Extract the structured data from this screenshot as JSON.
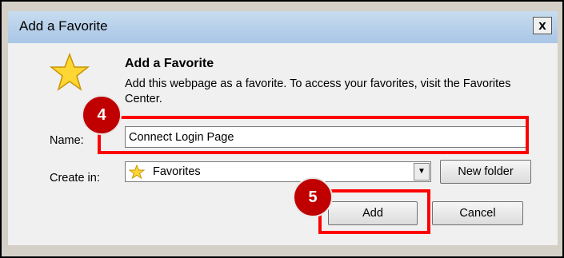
{
  "dialog": {
    "title": "Add a Favorite",
    "close_label": "x",
    "heading": "Add a Favorite",
    "description": "Add this webpage as a favorite. To access your favorites, visit the Favorites Center."
  },
  "form": {
    "name_label": "Name:",
    "name_value": "Connect Login Page",
    "create_in_label": "Create in:",
    "create_in_selected": "Favorites",
    "new_folder_label": "New folder"
  },
  "buttons": {
    "add_label": "Add",
    "cancel_label": "Cancel"
  },
  "annotations": {
    "step_4": "4",
    "step_5": "5",
    "highlight_color": "#ff0000",
    "badge_color": "#c00000"
  },
  "icons": {
    "favorite_large": "star-icon",
    "favorite_small": "star-icon",
    "dropdown": "chevron-down-icon"
  }
}
